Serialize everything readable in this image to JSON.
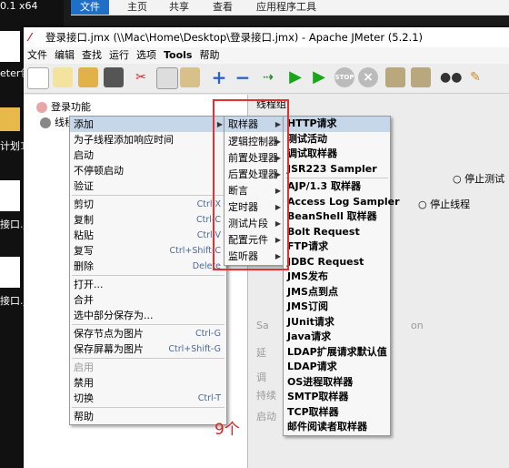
{
  "desktop": {
    "label_top": "0.1 x64",
    "label_meter": "eter包",
    "label_plan": "计划1",
    "label_jmx1": "接口.jm",
    "label_jmx2": "接口.jm"
  },
  "ribbon": {
    "tabs": [
      "文件",
      "主页",
      "共享",
      "查看",
      "应用程序工具"
    ]
  },
  "window": {
    "title": "登录接口.jmx (\\\\Mac\\Home\\Desktop\\登录接口.jmx) - Apache JMeter (5.2.1)",
    "menubar": [
      "文件",
      "编辑",
      "查找",
      "运行",
      "选项",
      "Tools",
      "帮助"
    ]
  },
  "tree": {
    "root": "登录功能",
    "child": "线程组"
  },
  "right_panel": {
    "header": "线程组",
    "stop_thread": "停止线程",
    "stop_test": "停止测试",
    "faint1": "延",
    "faint2": "调",
    "faint3": "持续",
    "faint4": "启动",
    "faint5": "Sa",
    "faint6": "on"
  },
  "context_menu": [
    {
      "label": "添加",
      "sub": true,
      "selected": true
    },
    {
      "label": "为子线程添加响应时间"
    },
    {
      "label": "启动"
    },
    {
      "label": "不停顿启动"
    },
    {
      "label": "验证"
    },
    {
      "label": "剪切",
      "shortcut": "Ctrl-X"
    },
    {
      "label": "复制",
      "shortcut": "Ctrl-C"
    },
    {
      "label": "粘贴",
      "shortcut": "Ctrl-V"
    },
    {
      "label": "复写",
      "shortcut": "Ctrl+Shift-C"
    },
    {
      "label": "删除",
      "shortcut": "Delete"
    },
    {
      "label": "打开..."
    },
    {
      "label": "合并"
    },
    {
      "label": "选中部分保存为..."
    },
    {
      "label": "保存节点为图片",
      "shortcut": "Ctrl-G"
    },
    {
      "label": "保存屏幕为图片",
      "shortcut": "Ctrl+Shift-G"
    },
    {
      "label": "启用",
      "disabled": true
    },
    {
      "label": "禁用"
    },
    {
      "label": "切换",
      "shortcut": "Ctrl-T"
    },
    {
      "label": "帮助"
    }
  ],
  "add_submenu": [
    "取样器",
    "逻辑控制器",
    "前置处理器",
    "后置处理器",
    "断言",
    "定时器",
    "测试片段",
    "配置元件",
    "监听器"
  ],
  "sampler_submenu": [
    "HTTP请求",
    "测试活动",
    "调试取样器",
    "JSR223 Sampler",
    "AJP/1.3 取样器",
    "Access Log Sampler",
    "BeanShell 取样器",
    "Bolt Request",
    "FTP请求",
    "JDBC Request",
    "JMS发布",
    "JMS点到点",
    "JMS订阅",
    "JUnit请求",
    "Java请求",
    "LDAP扩展请求默认值",
    "LDAP请求",
    "OS进程取样器",
    "SMTP取样器",
    "TCP取样器",
    "邮件阅读者取样器"
  ],
  "annotation": "9个",
  "colors": {
    "highlight": "#c7d7ea",
    "red_box": "#e53030",
    "annotation": "#e02020"
  }
}
